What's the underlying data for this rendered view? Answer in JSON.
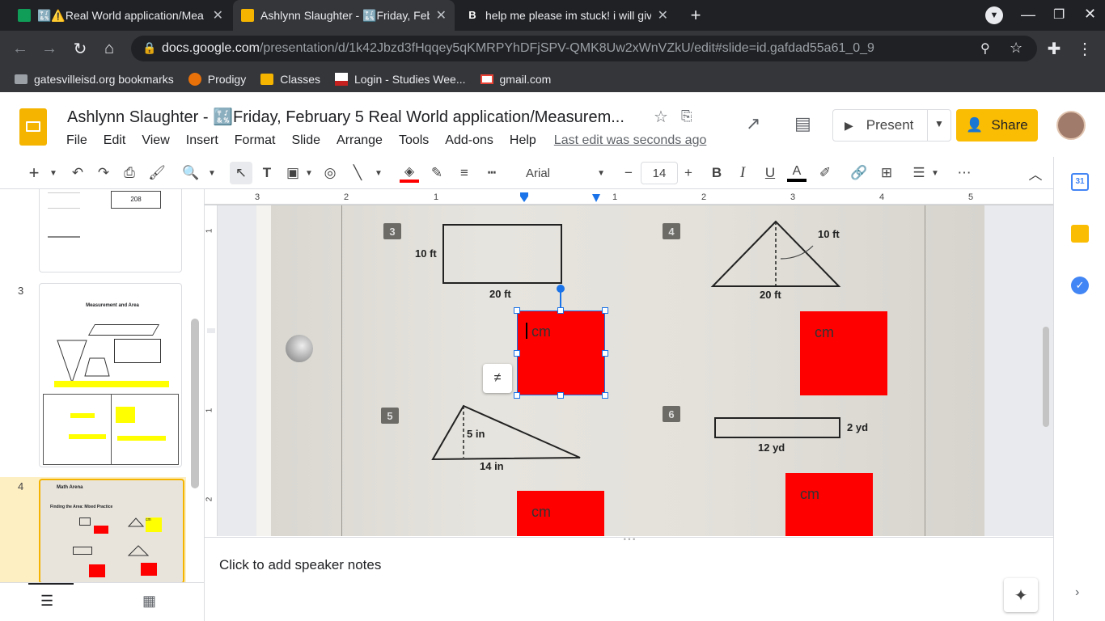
{
  "browser": {
    "tabs": [
      {
        "title": "🔣⚠️Real World application/Mea",
        "active": false
      },
      {
        "title": "Ashlynn Slaughter - 🔣Friday, Feb",
        "active": true
      },
      {
        "title": "help me please im stuck! i will giv",
        "active": false
      }
    ],
    "url_host": "docs.google.com",
    "url_path": "/presentation/d/1k42Jbzd3fHqqey5qKMRPYhDFjSPV-QMK8Uw2xWnVZkU/edit#slide=id.gafdad55a61_0_9",
    "bookmarks": [
      "gatesvilleisd.org bookmarks",
      "Prodigy",
      "Classes",
      "Login - Studies Wee...",
      "gmail.com"
    ]
  },
  "doc": {
    "title": "Ashlynn Slaughter - 🔣Friday, February 5 Real World application/Measurem...",
    "menus": [
      "File",
      "Edit",
      "View",
      "Insert",
      "Format",
      "Slide",
      "Arrange",
      "Tools",
      "Add-ons",
      "Help"
    ],
    "last_edit": "Last edit was seconds ago",
    "present_label": "Present",
    "share_label": "Share"
  },
  "toolbar": {
    "font": "Arial",
    "font_size": "14"
  },
  "ruler": {
    "ticks": [
      "3",
      "2",
      "1",
      "1",
      "1",
      "2",
      "3",
      "4",
      "5"
    ]
  },
  "vruler": {
    "ticks": [
      "1",
      "1",
      "2"
    ]
  },
  "filmstrip": {
    "slide_numbers": [
      "3",
      "4"
    ],
    "thumb_texts": [
      "208",
      "Measurement and Area",
      "Math Arena",
      "Finding the Area: Mixed Practice",
      "cm"
    ]
  },
  "slide": {
    "problems": [
      {
        "number": "3",
        "labels": [
          "10 ft",
          "20 ft"
        ]
      },
      {
        "number": "4",
        "labels": [
          "10 ft",
          "20 ft"
        ]
      },
      {
        "number": "5",
        "labels": [
          "5 in",
          "14 in"
        ]
      },
      {
        "number": "6",
        "labels": [
          "2 yd",
          "12 yd"
        ]
      }
    ],
    "answer_boxes": [
      "cm",
      "cm",
      "cm",
      "cm"
    ],
    "colors": {
      "answer_fill": "#ff0000",
      "selection": "#1a73e8"
    }
  },
  "notes": {
    "placeholder": "Click to add speaker notes"
  }
}
